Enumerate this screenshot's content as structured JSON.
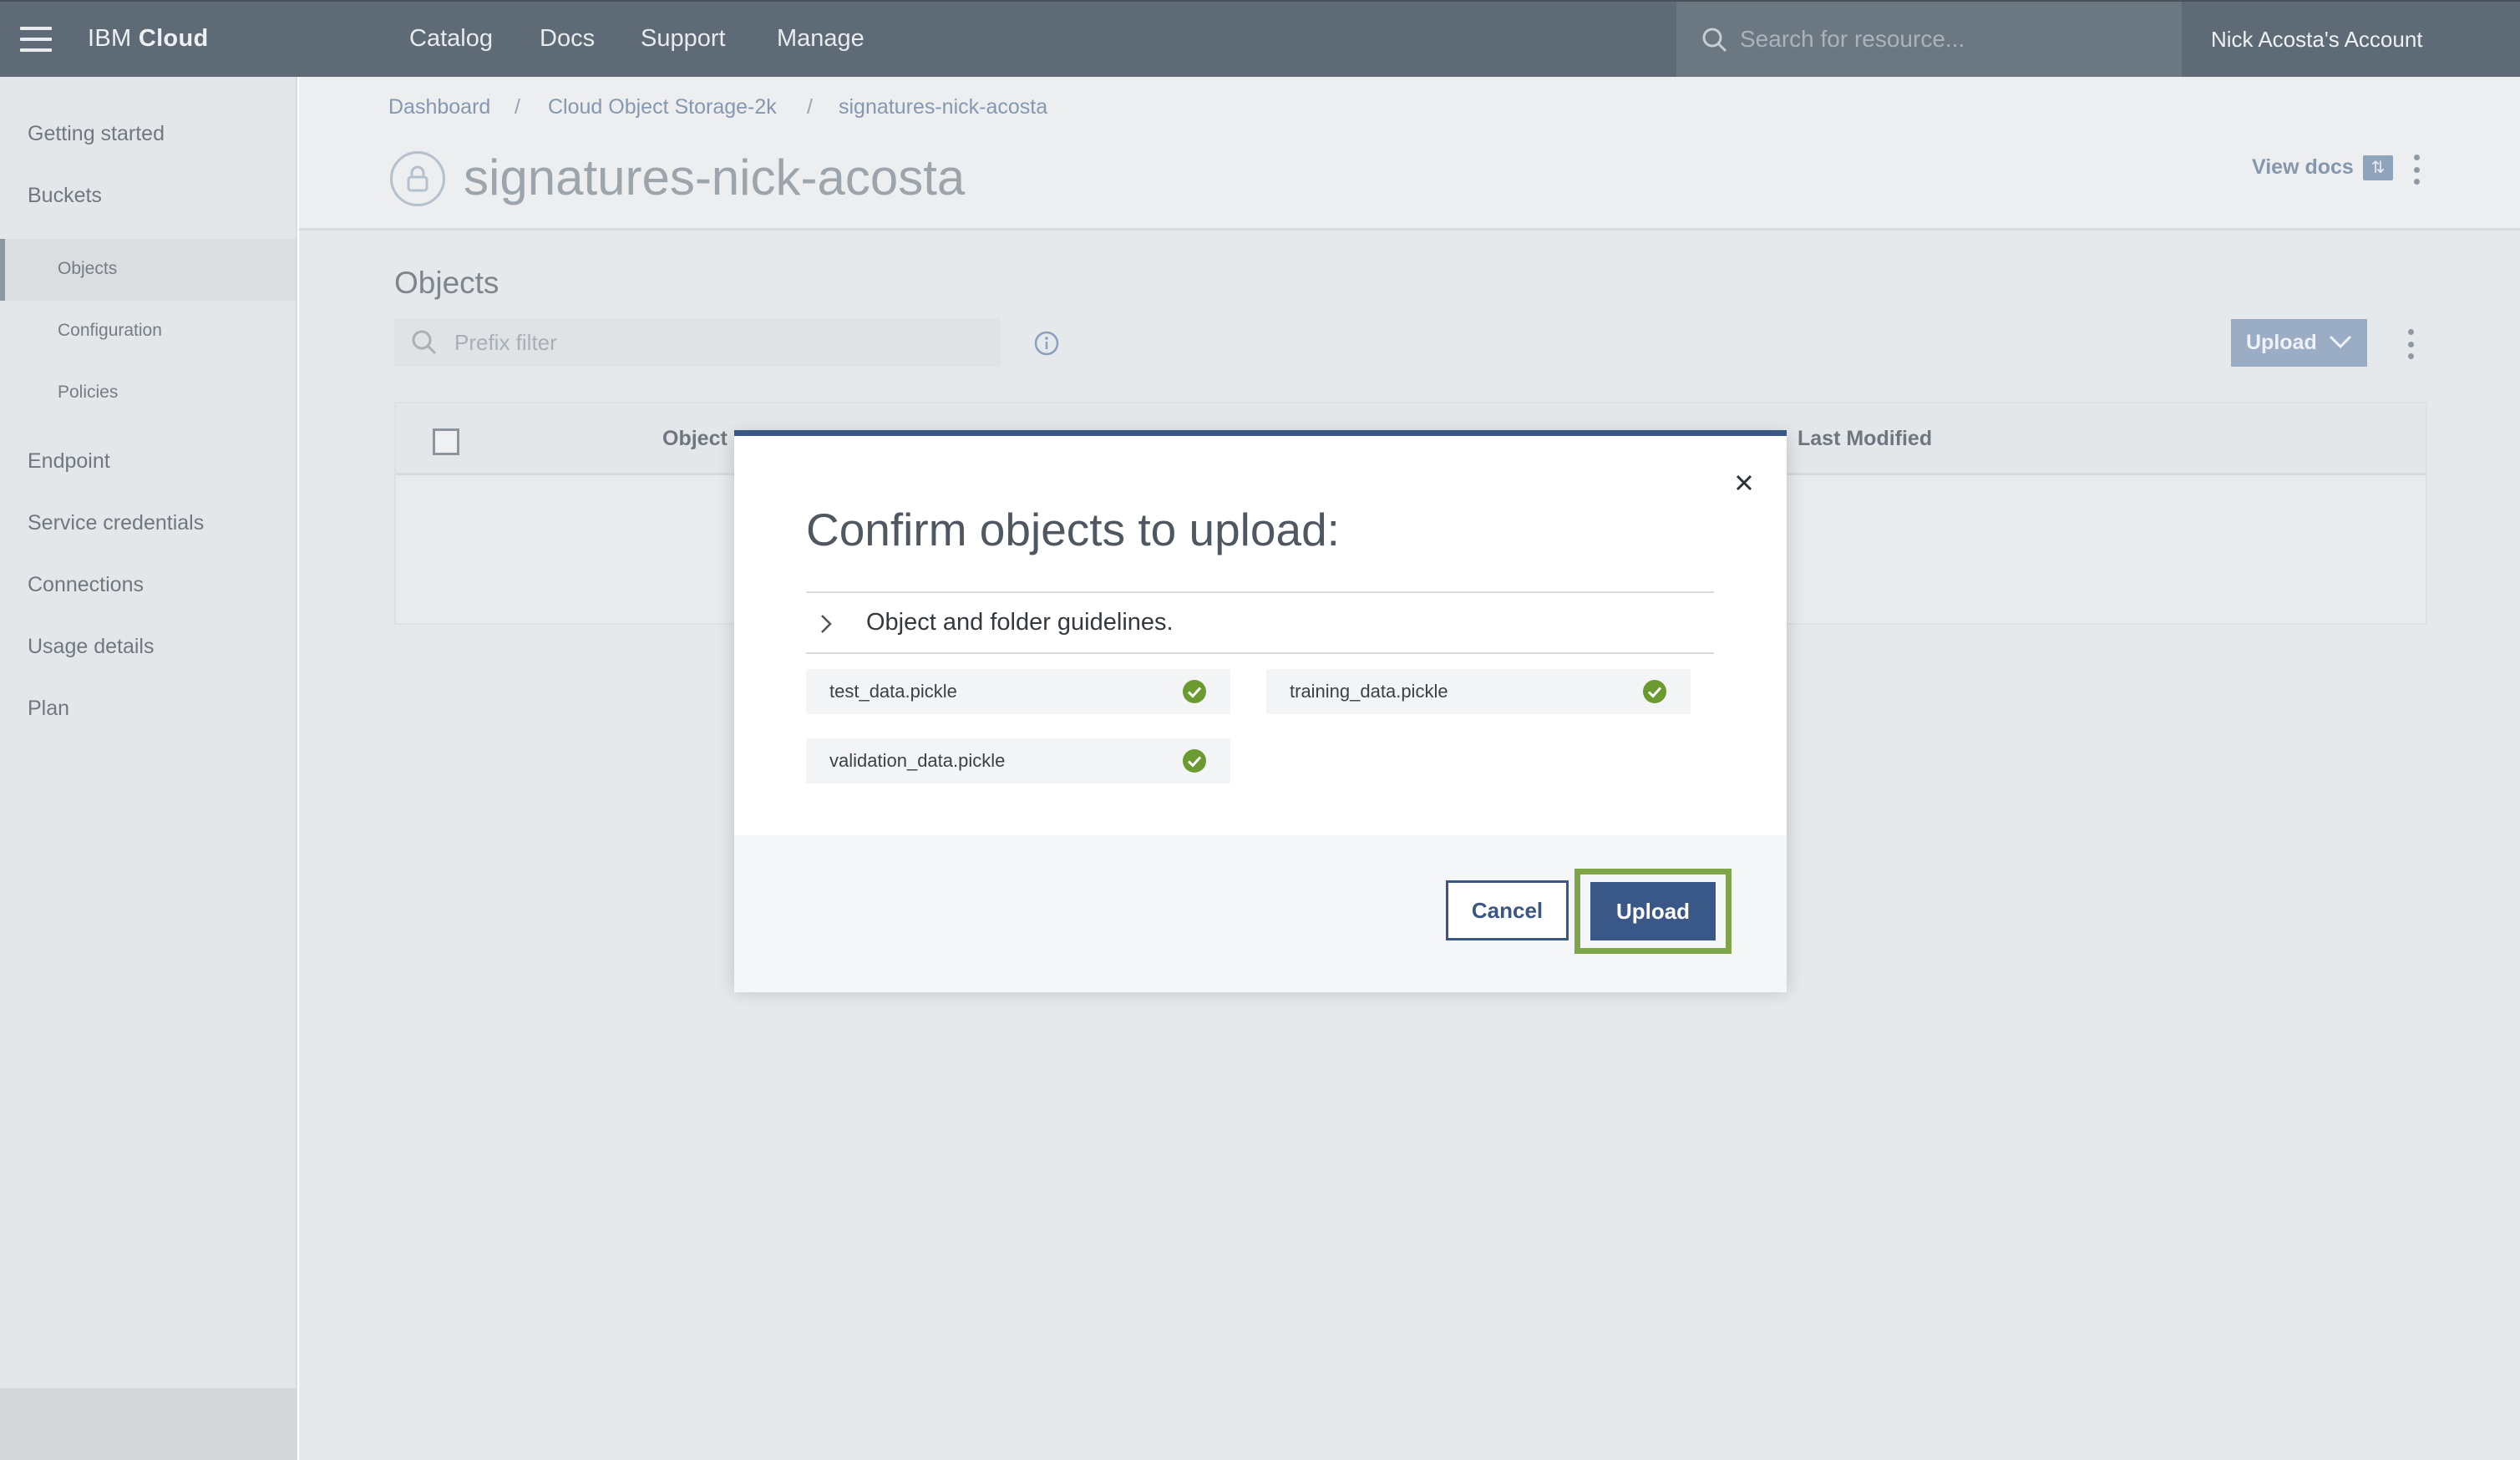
{
  "topbar": {
    "brand_prefix": "IBM",
    "brand_name": "Cloud",
    "nav": [
      "Catalog",
      "Docs",
      "Support",
      "Manage"
    ],
    "search_placeholder": "Search for resource...",
    "account": "Nick Acosta's Account"
  },
  "sidebar": {
    "items": [
      "Getting started",
      "Buckets",
      "Endpoint",
      "Service credentials",
      "Connections",
      "Usage details",
      "Plan"
    ],
    "sub_items": [
      "Objects",
      "Configuration",
      "Policies"
    ],
    "active": "Objects"
  },
  "breadcrumb": [
    "Dashboard",
    "Cloud Object Storage-2k",
    "signatures-nick-acosta"
  ],
  "bucket": {
    "title": "signatures-nick-acosta",
    "view_docs": "View docs"
  },
  "objects": {
    "title": "Objects",
    "filter_placeholder": "Prefix filter",
    "upload_label": "Upload",
    "columns": [
      "Object N",
      "Last Modified"
    ]
  },
  "modal": {
    "title": "Confirm objects to upload:",
    "guidelines": "Object and folder guidelines.",
    "files": [
      "test_data.pickle",
      "training_data.pickle",
      "validation_data.pickle"
    ],
    "cancel": "Cancel",
    "upload": "Upload"
  },
  "colors": {
    "topbar": "#5e6a75",
    "primary": "#3a5887",
    "success": "#6a9a30",
    "highlight": "#7fa54a"
  }
}
